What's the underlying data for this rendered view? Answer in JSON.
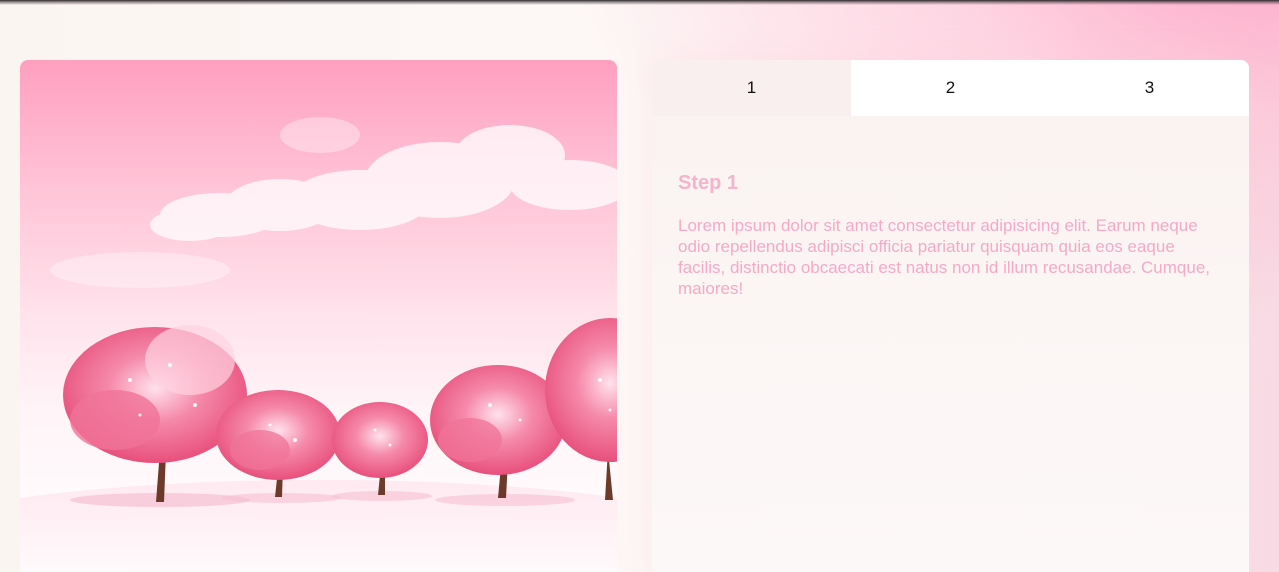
{
  "image": {
    "icon": "cherry-blossom-landscape-image",
    "sky_color": "#ff9fc0",
    "blossom_color": "#f0628c"
  },
  "tabs": [
    {
      "label": "1",
      "active": true
    },
    {
      "label": "2",
      "active": false
    },
    {
      "label": "3",
      "active": false
    }
  ],
  "step": {
    "title": "Step 1",
    "text": "Lorem ipsum dolor sit amet consectetur adipisicing elit. Earum neque odio repellendus adipisci officia pariatur quisquam quia eos eaque facilis, distinctio obcaecati est natus non id illum recusandae. Cumque, maiores!"
  },
  "colors": {
    "accent_pink": "#f4aac7",
    "active_tab_bg": "#f8efee"
  }
}
